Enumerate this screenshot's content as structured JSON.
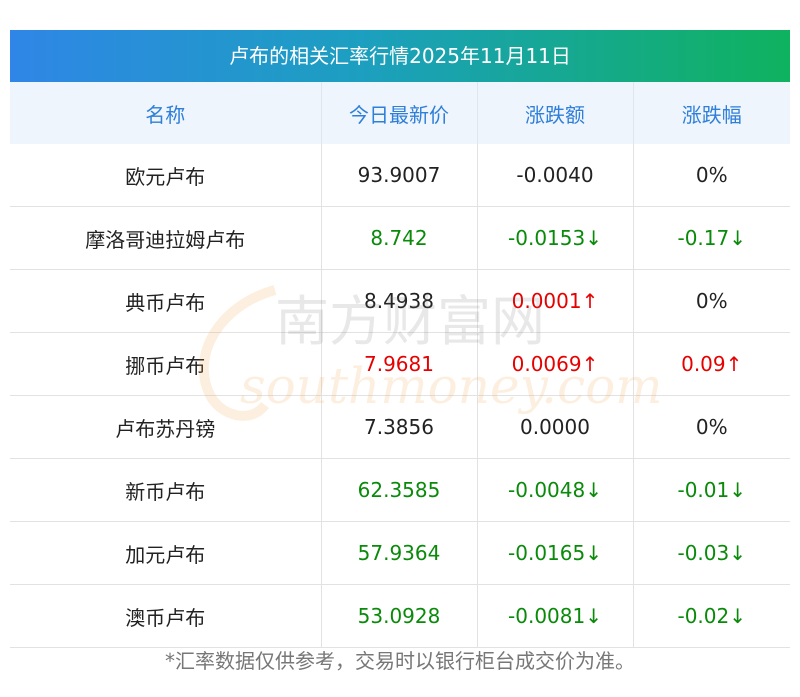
{
  "title": "卢布的相关汇率行情2025年11月11日",
  "columns": [
    "名称",
    "今日最新价",
    "涨跌额",
    "涨跌幅"
  ],
  "rows": [
    {
      "name": "欧元卢布",
      "price": "93.9007",
      "change": "-0.0040",
      "pct": "0%",
      "price_dir": "flat",
      "change_dir": "flat",
      "pct_dir": "flat"
    },
    {
      "name": "摩洛哥迪拉姆卢布",
      "price": "8.742",
      "change": "-0.0153↓",
      "pct": "-0.17↓",
      "price_dir": "down",
      "change_dir": "down",
      "pct_dir": "down"
    },
    {
      "name": "典币卢布",
      "price": "8.4938",
      "change": "0.0001↑",
      "pct": "0%",
      "price_dir": "flat",
      "change_dir": "up",
      "pct_dir": "flat"
    },
    {
      "name": "挪币卢布",
      "price": "7.9681",
      "change": "0.0069↑",
      "pct": "0.09↑",
      "price_dir": "up",
      "change_dir": "up",
      "pct_dir": "up"
    },
    {
      "name": "卢布苏丹镑",
      "price": "7.3856",
      "change": "0.0000",
      "pct": "0%",
      "price_dir": "flat",
      "change_dir": "flat",
      "pct_dir": "flat"
    },
    {
      "name": "新币卢布",
      "price": "62.3585",
      "change": "-0.0048↓",
      "pct": "-0.01↓",
      "price_dir": "down",
      "change_dir": "down",
      "pct_dir": "down"
    },
    {
      "name": "加元卢布",
      "price": "57.9364",
      "change": "-0.0165↓",
      "pct": "-0.03↓",
      "price_dir": "down",
      "change_dir": "down",
      "pct_dir": "down"
    },
    {
      "name": "澳币卢布",
      "price": "53.0928",
      "change": "-0.0081↓",
      "pct": "-0.02↓",
      "price_dir": "down",
      "change_dir": "down",
      "pct_dir": "down"
    }
  ],
  "watermark": {
    "cn": "南方财富网",
    "en": "southmoney.com"
  },
  "footer": "*汇率数据仅供参考，交易时以银行柜台成交价为准。",
  "colors": {
    "up": "#e60000",
    "down": "#0a8a0a",
    "header_text": "#2f7fd8"
  }
}
